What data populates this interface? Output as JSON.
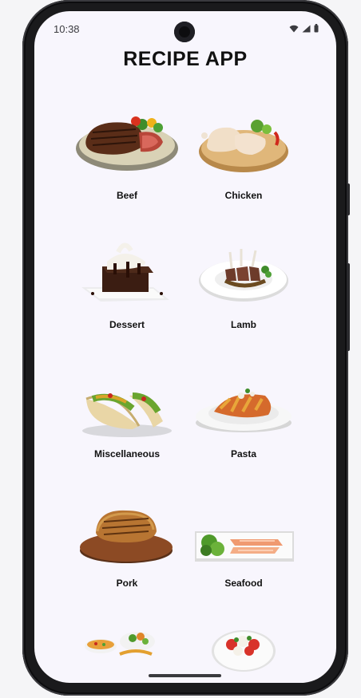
{
  "status_bar": {
    "time": "10:38",
    "icons": [
      "wifi-icon",
      "signal-icon",
      "battery-icon"
    ]
  },
  "app": {
    "title": "RECIPE APP"
  },
  "categories": [
    {
      "label": "Beef"
    },
    {
      "label": "Chicken"
    },
    {
      "label": "Dessert"
    },
    {
      "label": "Lamb"
    },
    {
      "label": "Miscellaneous"
    },
    {
      "label": "Pasta"
    },
    {
      "label": "Pork"
    },
    {
      "label": "Seafood"
    },
    {
      "label": ""
    },
    {
      "label": ""
    }
  ],
  "colors": {
    "screen_bg": "#f8f6fd",
    "text": "#111111",
    "bezel": "#1a1a1c"
  }
}
